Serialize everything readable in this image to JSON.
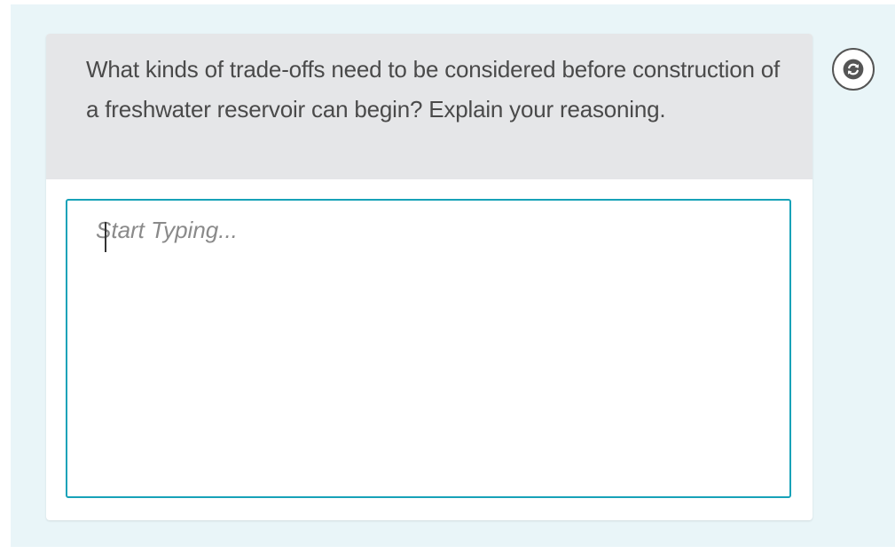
{
  "question": {
    "text": "What kinds of trade-offs need to be considered before construction of a freshwater reservoir can begin? Explain your reasoning."
  },
  "answer": {
    "value": "",
    "placeholder": "Start Typing..."
  },
  "refresh_button": {
    "icon": "refresh-icon"
  },
  "colors": {
    "background": "#e9f5f8",
    "prompt_background": "#e5e6e8",
    "input_border": "#17a2b8",
    "text": "#4a4a4a"
  }
}
